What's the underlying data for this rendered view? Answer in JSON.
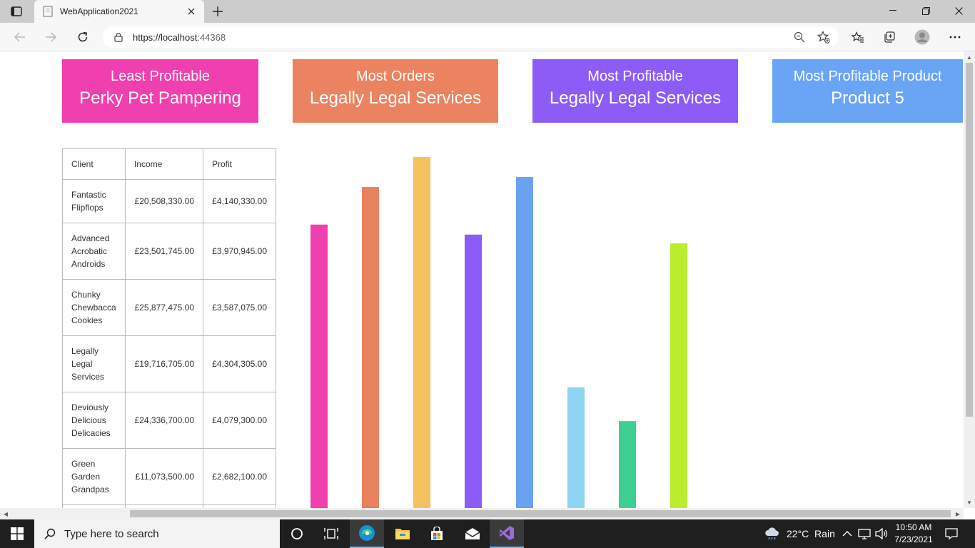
{
  "browser": {
    "tab_title": "WebApplication2021",
    "url_scheme_host": "https://localhost",
    "url_port": ":44368"
  },
  "cards": [
    {
      "label": "Least Profitable",
      "value": "Perky Pet Pampering",
      "color": "#f03fae"
    },
    {
      "label": "Most Orders",
      "value": "Legally Legal Services",
      "color": "#ec8360"
    },
    {
      "label": "Most Profitable",
      "value": "Legally Legal Services",
      "color": "#8d5cf6"
    },
    {
      "label": "Most Profitable Product",
      "value": "Product 5",
      "color": "#6aa4f5"
    }
  ],
  "table": {
    "headers": [
      "Client",
      "Income",
      "Profit"
    ],
    "rows": [
      {
        "client": "Fantastic Flipflops",
        "income": "£20,508,330.00",
        "profit": "£4,140,330.00"
      },
      {
        "client": "Advanced Acrobatic Androids",
        "income": "£23,501,745.00",
        "profit": "£3,970,945.00"
      },
      {
        "client": "Chunky Chewbacca Cookies",
        "income": "£25,877,475.00",
        "profit": "£3,587,075.00"
      },
      {
        "client": "Legally Legal Services",
        "income": "£19,716,705.00",
        "profit": "£4,304,305.00"
      },
      {
        "client": "Deviously Delicious Delicacies",
        "income": "£24,336,700.00",
        "profit": "£4,079,300.00"
      },
      {
        "client": "Green Garden Grandpas",
        "income": "£11,073,500.00",
        "profit": "£2,682,100.00"
      }
    ]
  },
  "chart_data": {
    "type": "bar",
    "series": [
      {
        "values": [
          23.1,
          26.1,
          28.5,
          22.3,
          26.9,
          10.1,
          7.4,
          21.6
        ],
        "colors": [
          "#f03fae",
          "#e8825f",
          "#f5c25f",
          "#8d5cf6",
          "#6aa1f0",
          "#90d4f3",
          "#3ecf95",
          "#bbec2e"
        ]
      }
    ]
  },
  "taskbar": {
    "search_placeholder": "Type here to search",
    "weather": "22°C  Rain",
    "time": "10:50 AM",
    "date": "7/23/2021"
  }
}
